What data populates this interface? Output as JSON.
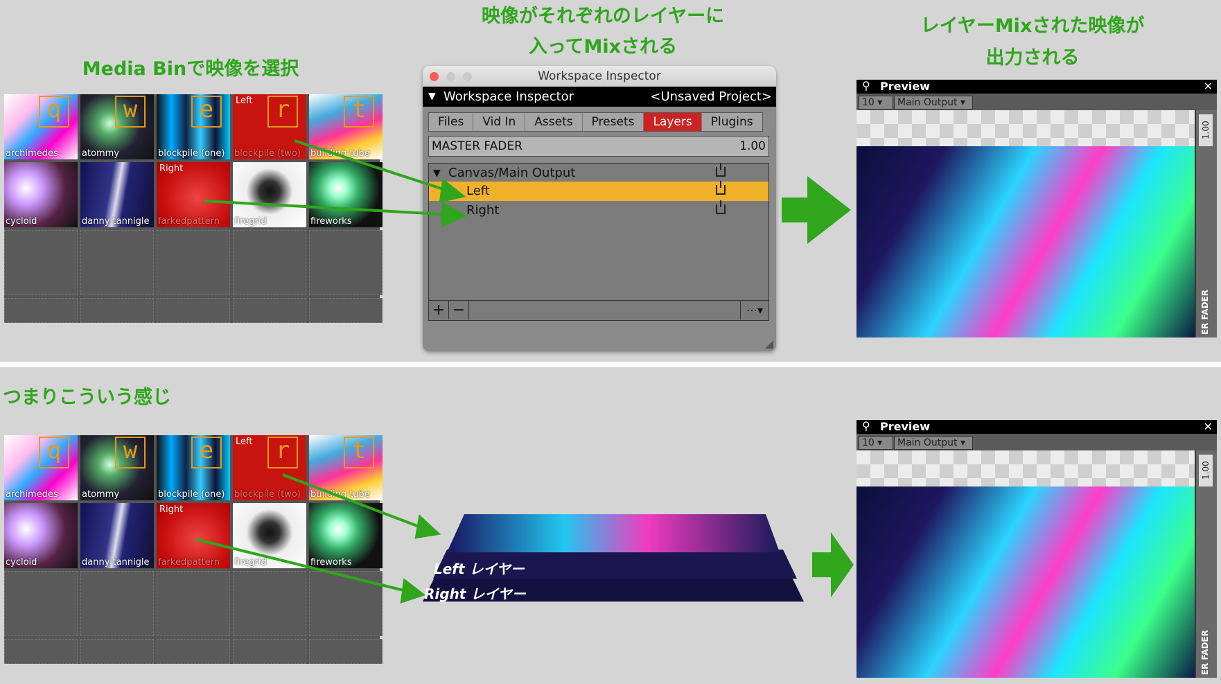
{
  "captions": {
    "media_bin": "Media Binで映像を選択",
    "layers_line1": "映像がそれぞれのレイヤーに",
    "layers_line2": "入ってMixされる",
    "output_line1": "レイヤーMixされた映像が",
    "output_line2": "出力される",
    "summary": "つまりこういう感じ"
  },
  "media_bin": {
    "clips": [
      {
        "name": "archimedes",
        "key": "q"
      },
      {
        "name": "atommy",
        "key": "w"
      },
      {
        "name": "blockpile (one)",
        "key": "e"
      },
      {
        "name": "blockpile (two)",
        "key": "r",
        "tag": "Left"
      },
      {
        "name": "building tube",
        "key": "t"
      },
      {
        "name": "cycloid",
        "key": ""
      },
      {
        "name": "danny tannigle",
        "key": ""
      },
      {
        "name": "farkedpattern",
        "key": "",
        "tag": "Right"
      },
      {
        "name": "firegrid",
        "key": ""
      },
      {
        "name": "fireworks",
        "key": ""
      }
    ]
  },
  "inspector": {
    "window_title": "Workspace Inspector",
    "header_title": "Workspace Inspector",
    "project": "<Unsaved Project>",
    "tabs": [
      "Files",
      "Vid In",
      "Assets",
      "Presets",
      "Layers",
      "Plugins"
    ],
    "active_tab": "Layers",
    "master_fader_label": "MASTER FADER",
    "master_fader_value": "1.00",
    "group": "Canvas/Main Output",
    "layers": [
      "Left",
      "Right"
    ],
    "add_label": "+",
    "remove_label": "−"
  },
  "preview": {
    "title": "Preview",
    "zoom": "10",
    "output": "Main Output",
    "fader_value": "1.00",
    "fader_label": "ER FADER"
  },
  "stack": {
    "left_label": "Left レイヤー",
    "right_label": "Right レイヤー"
  },
  "colors": {
    "caption_green": "#2fa61c",
    "active_tab": "#cc2222",
    "selected_layer": "#f0b12a",
    "key_orange": "#e59a1a"
  }
}
